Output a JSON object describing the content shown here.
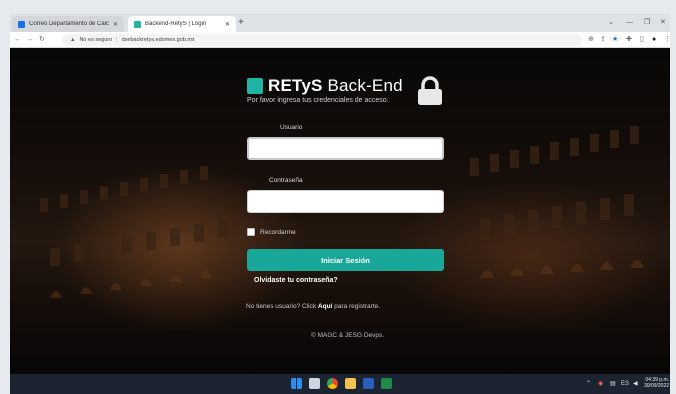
{
  "browser": {
    "tabs": [
      {
        "title": "Correo Departamento de Cálculo",
        "favicon_color": "#1a73e8"
      },
      {
        "title": "Backend-RetyS | Login",
        "favicon_color": "#1fb5a2"
      }
    ],
    "new_tab_icon": "+",
    "address": {
      "security_label": "No es seguro",
      "url": "dsebackretys.edomex.gob.mx"
    },
    "window_controls": [
      "minimize",
      "restore",
      "close"
    ]
  },
  "page": {
    "brand_bold": "RETyS",
    "brand_rest": " Back-End",
    "subtitle": "Por favor ingresa tus credenciales de acceso.",
    "username_label": "Usuario",
    "username_value": "",
    "password_label": "Contraseña",
    "password_value": "",
    "remember_label": "Recordarme",
    "remember_checked": false,
    "login_button": "Iniciar Sesión",
    "forgot_link": "Olvidaste tu contraseña?",
    "register_prefix": "No tienes usuario? Click ",
    "register_link": "Aquí",
    "register_suffix": " para registrarte.",
    "footer": "© MAGC & JESG Devps."
  },
  "taskbar": {
    "apps": [
      "windows-start",
      "task-view",
      "chrome",
      "file-explorer",
      "word",
      "excel"
    ],
    "tray": [
      "chevron-up",
      "network",
      "wifi",
      "language",
      "volume"
    ],
    "time": "04:39 p.m.",
    "date": "30/09/2022"
  }
}
